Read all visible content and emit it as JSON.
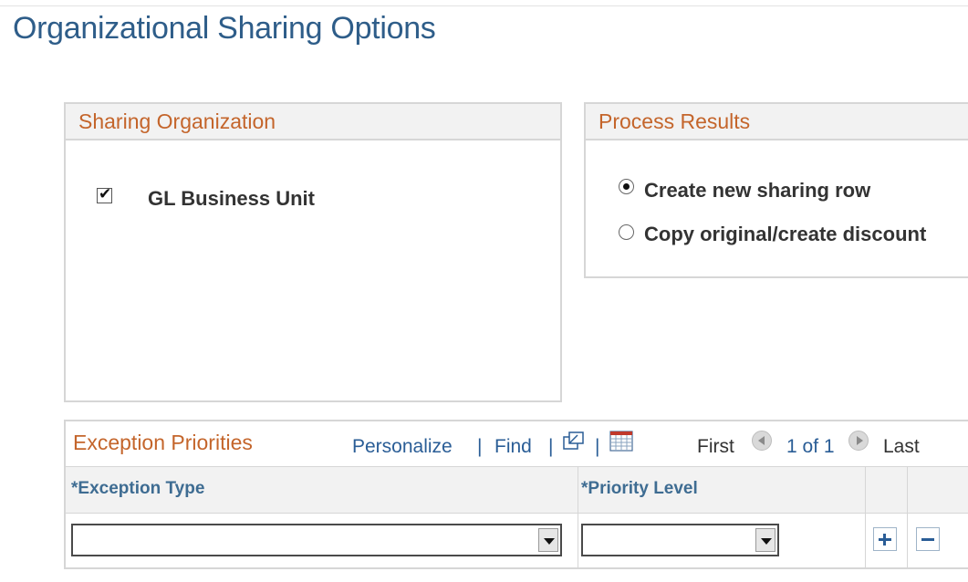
{
  "page": {
    "title": "Organizational Sharing Options"
  },
  "sharing_organization": {
    "header": "Sharing Organization",
    "checkbox": {
      "label": "GL Business Unit",
      "checked": true
    }
  },
  "process_results": {
    "header": "Process Results",
    "options": [
      {
        "label": "Create new sharing row",
        "selected": true
      },
      {
        "label": "Copy original/create discount",
        "selected": false
      }
    ]
  },
  "exception_priorities": {
    "title": "Exception Priorities",
    "toolbar": {
      "personalize": "Personalize",
      "separator": "|",
      "find": "Find",
      "first": "First",
      "pagination": "1 of 1",
      "last": "Last",
      "view_all_icon": "new-window-icon",
      "download_icon": "grid-download-icon"
    },
    "columns": [
      "*Exception Type",
      "*Priority Level"
    ],
    "row": {
      "exception_type": "",
      "priority_level": ""
    }
  },
  "colors": {
    "title": "#2e5d89",
    "group_header_text": "#c4652b",
    "link": "#2a5d96",
    "column_header": "#3e6c92"
  }
}
